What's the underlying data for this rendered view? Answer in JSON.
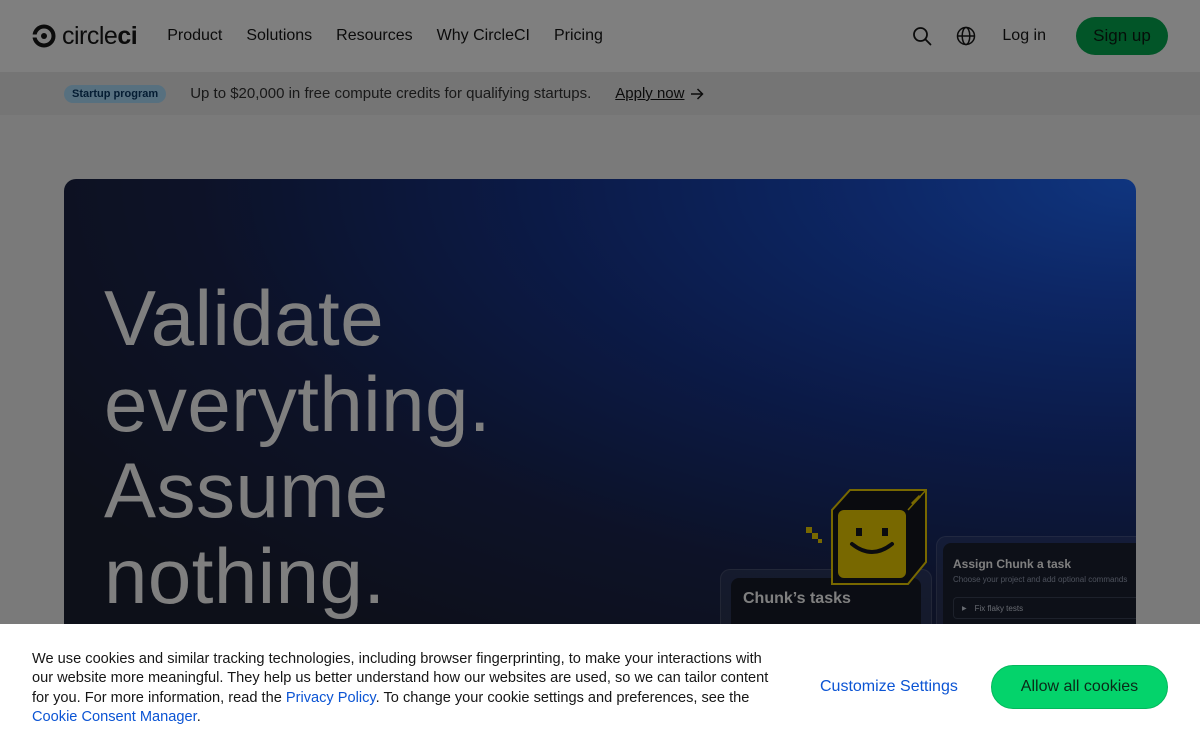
{
  "header": {
    "logo_text_light": "circle",
    "logo_text_bold": "ci",
    "nav": [
      {
        "label": "Product"
      },
      {
        "label": "Solutions"
      },
      {
        "label": "Resources"
      },
      {
        "label": "Why CircleCI"
      },
      {
        "label": "Pricing"
      }
    ],
    "search_icon": "search-icon",
    "globe_icon": "globe-icon",
    "login_label": "Log in",
    "signup_label": "Sign up"
  },
  "promo": {
    "badge": "Startup program",
    "text": "Up to $20,000 in free compute credits for qualifying startups.",
    "link_label": "Apply now",
    "link_icon": "arrow-right-icon"
  },
  "hero": {
    "title_lines": [
      "Validate",
      "everything.",
      "Assume",
      "nothing."
    ],
    "tasks_card_title": "Chunk’s tasks",
    "assign_title": "Assign Chunk a task",
    "assign_subtitle": "Choose your project and add optional commands",
    "assign_row": "Fix flaky tests"
  },
  "cookie": {
    "text_1": "We use cookies and similar tracking technologies, including browser fingerprinting, to make your interactions with our website more meaningful. They help us better understand how our websites are used, so we can tailor content for you. For more information, read the ",
    "privacy_link": "Privacy Policy",
    "text_2": ". To change your cookie settings and preferences, see the ",
    "consent_link": "Cookie Consent Manager",
    "text_3": ".",
    "customize_label": "Customize Settings",
    "allow_label": "Allow all cookies"
  },
  "colors": {
    "brand_green": "#04AA51",
    "cookie_green": "#04D36B",
    "link_blue": "#0b54d4",
    "chunk_yellow": "#F0D000"
  }
}
